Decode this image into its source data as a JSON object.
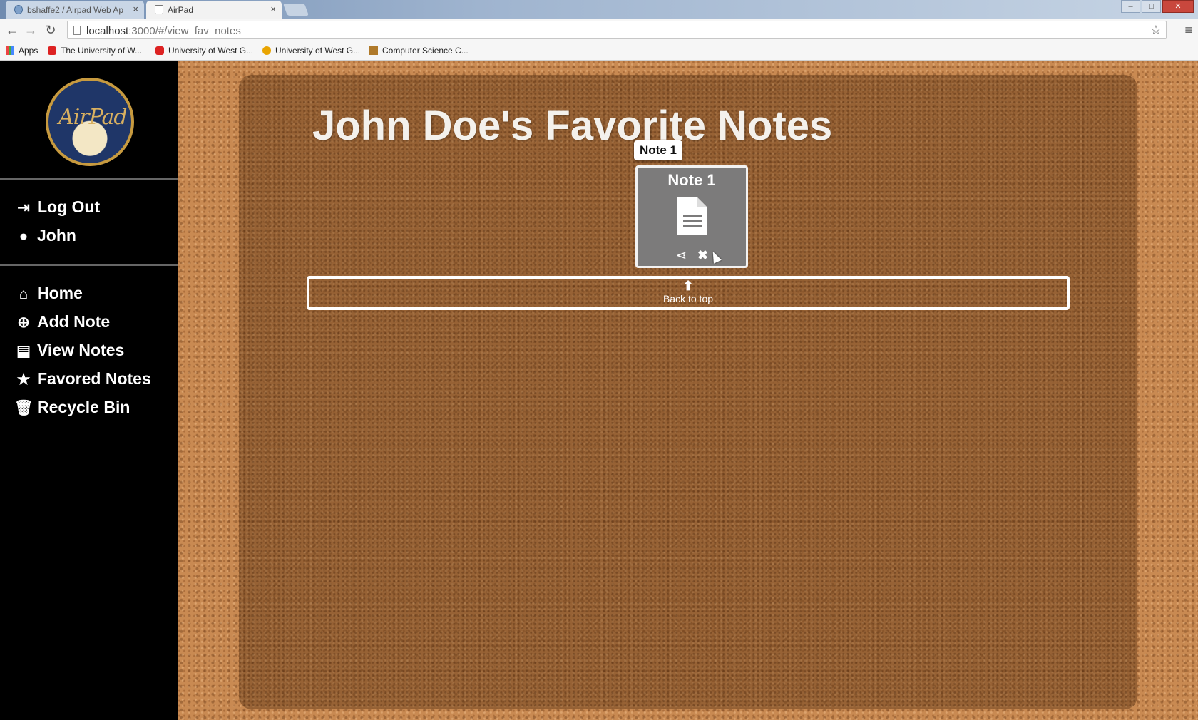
{
  "browser": {
    "tabs": [
      {
        "title": "bshaffe2 / Airpad Web Ap",
        "close": "×"
      },
      {
        "title": "AirPad",
        "close": "×"
      }
    ],
    "window_controls": {
      "minimize": "–",
      "maximize": "□",
      "close": "✕"
    },
    "url_host": "localhost",
    "url_rest": ":3000/#/view_fav_notes",
    "bookmarks": [
      {
        "label": "Apps"
      },
      {
        "label": "The University of W..."
      },
      {
        "label": "University of West G..."
      },
      {
        "label": "University of West G..."
      },
      {
        "label": "Computer Science C..."
      }
    ]
  },
  "sidebar": {
    "logo_text": "AirPad",
    "user_items": [
      {
        "label": "Log Out",
        "icon": "sign-out-icon"
      },
      {
        "label": "John",
        "icon": "user-icon"
      }
    ],
    "nav_items": [
      {
        "label": "Home",
        "icon": "home-icon"
      },
      {
        "label": "Add Note",
        "icon": "plus-circle-icon"
      },
      {
        "label": "View Notes",
        "icon": "file-icon"
      },
      {
        "label": "Favored Notes",
        "icon": "star-icon"
      },
      {
        "label": "Recycle Bin",
        "icon": "trash-icon"
      }
    ]
  },
  "main": {
    "title": "John Doe's Favorite Notes",
    "tooltip": "Note 1",
    "notes": [
      {
        "title": "Note 1"
      }
    ],
    "back_to_top": {
      "arrow": "⬆",
      "label": "Back to top"
    }
  },
  "colors": {
    "sidebar_bg": "#000000",
    "cork": "#c98a52",
    "card_bg": "#7c7b7b"
  }
}
